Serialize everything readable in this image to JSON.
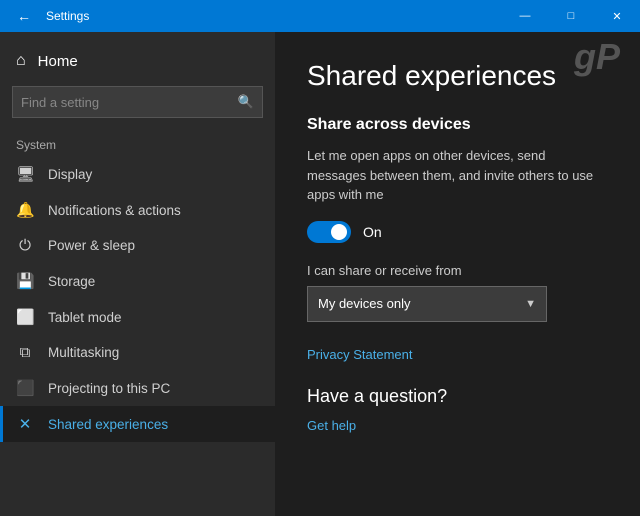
{
  "titlebar": {
    "back_label": "←",
    "title": "Settings",
    "minimize": "—",
    "maximize": "□",
    "close": "✕"
  },
  "sidebar": {
    "home_label": "Home",
    "search_placeholder": "Find a setting",
    "search_icon": "🔍",
    "section_label": "System",
    "nav_items": [
      {
        "id": "display",
        "label": "Display",
        "icon": "🖥"
      },
      {
        "id": "notifications",
        "label": "Notifications & actions",
        "icon": "🔔"
      },
      {
        "id": "power",
        "label": "Power & sleep",
        "icon": "⏻"
      },
      {
        "id": "storage",
        "label": "Storage",
        "icon": "💾"
      },
      {
        "id": "tablet",
        "label": "Tablet mode",
        "icon": "📱"
      },
      {
        "id": "multitasking",
        "label": "Multitasking",
        "icon": "⧉"
      },
      {
        "id": "projecting",
        "label": "Projecting to this PC",
        "icon": "📺"
      },
      {
        "id": "shared",
        "label": "Shared experiences",
        "icon": "✕",
        "active": true
      }
    ]
  },
  "content": {
    "page_title": "Shared experiences",
    "section_title": "Share across devices",
    "description": "Let me open apps on other devices, send messages between them, and invite others to use apps with me",
    "toggle_state": "On",
    "share_from_label": "I can share or receive from",
    "dropdown_value": "My devices only",
    "privacy_link": "Privacy Statement",
    "have_a_question": "Have a question?",
    "get_help": "Get help"
  },
  "watermark": "gP"
}
